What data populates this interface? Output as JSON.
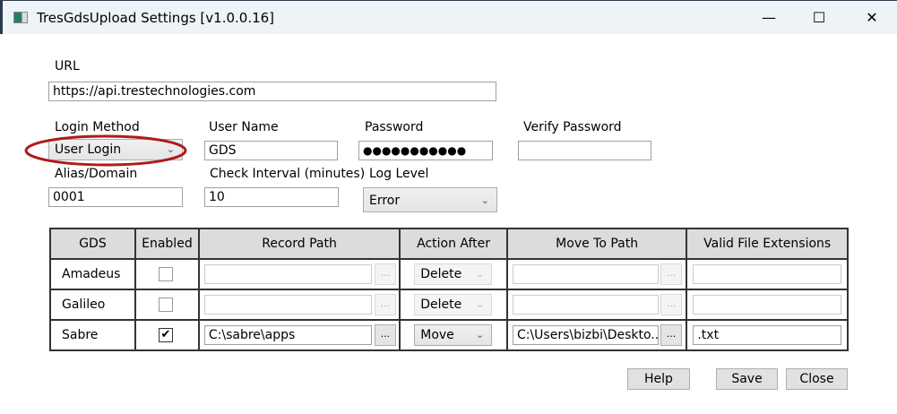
{
  "window": {
    "title": "TresGdsUpload Settings [v1.0.0.16]",
    "minimize": "—",
    "maximize": "☐",
    "close": "✕"
  },
  "form": {
    "url_label": "URL",
    "url_value": "https://api.trestechnologies.com",
    "login_method_label": "Login Method",
    "login_method_value": "User Login",
    "user_name_label": "User Name",
    "user_name_value": "GDS",
    "password_label": "Password",
    "password_value": "●●●●●●●●●●●",
    "verify_password_label": "Verify Password",
    "verify_password_value": "",
    "alias_label": "Alias/Domain",
    "alias_value": "0001",
    "interval_label": "Check Interval (minutes)",
    "interval_value": "10",
    "log_level_label": "Log Level",
    "log_level_value": "Error"
  },
  "annotation": {
    "color": "#b01a1a"
  },
  "table": {
    "headers": [
      "GDS",
      "Enabled",
      "Record Path",
      "Action After",
      "Move To Path",
      "Valid File Extensions"
    ],
    "browse_label": "...",
    "rows": [
      {
        "gds": "Amadeus",
        "enabled": false,
        "enabled_mark": "",
        "record_path": "",
        "action_after": "Delete",
        "move_to_path": "",
        "extensions": ""
      },
      {
        "gds": "Galileo",
        "enabled": false,
        "enabled_mark": "",
        "record_path": "",
        "action_after": "Delete",
        "move_to_path": "",
        "extensions": ""
      },
      {
        "gds": "Sabre",
        "enabled": true,
        "enabled_mark": "✔",
        "record_path": "C:\\sabre\\apps",
        "action_after": "Move",
        "move_to_path": "C:\\Users\\bizbi\\Deskto...",
        "extensions": ".txt"
      }
    ]
  },
  "buttons": {
    "help": "Help",
    "save": "Save",
    "close": "Close"
  }
}
